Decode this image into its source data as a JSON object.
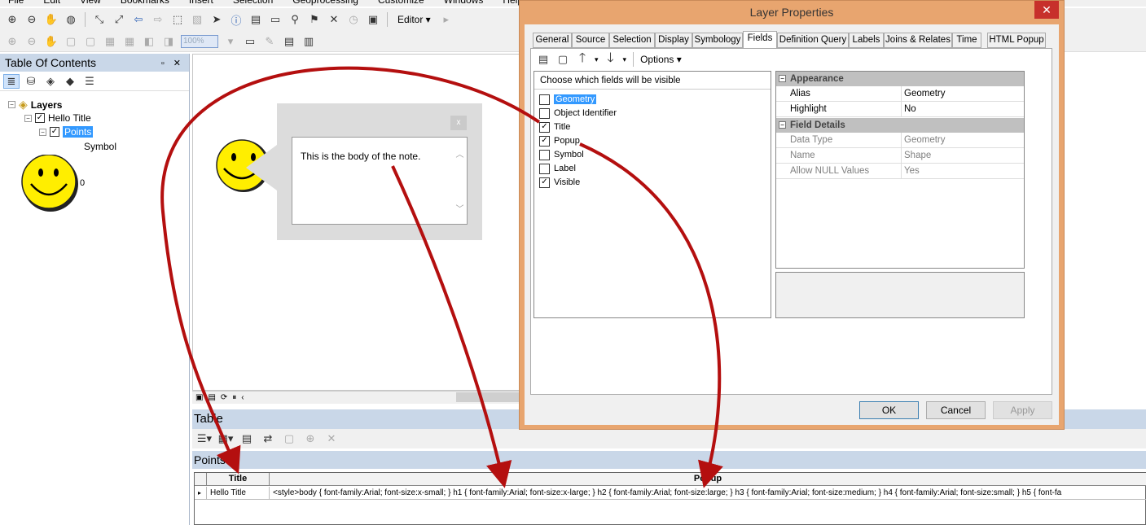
{
  "menu": [
    "File",
    "Edit",
    "View",
    "Bookmarks",
    "Insert",
    "Selection",
    "Geoprocessing",
    "Customize",
    "Windows",
    "Help"
  ],
  "toolbar": {
    "editor_label": "Editor ▾",
    "zoom_value": "100%"
  },
  "toc": {
    "title": "Table Of Contents",
    "controls": "▫ ✕",
    "layers_label": "Layers",
    "group_label": "Hello Title",
    "layer_label": "Points",
    "symbol_label": "Symbol",
    "legend_value": "0"
  },
  "note": {
    "close": "x",
    "body": "This is the body of the note."
  },
  "table": {
    "title": "Table",
    "tab_label": "Points",
    "columns": [
      "Title",
      "Popup"
    ],
    "rows": [
      {
        "title": "Hello Title",
        "popup": "<style>body { font-family:Arial; font-size:x-small; } h1 { font-family:Arial; font-size:x-large; } h2 { font-family:Arial; font-size:large; } h3 { font-family:Arial; font-size:medium; } h4 { font-family:Arial; font-size:small; } h5 { font-fa"
      }
    ]
  },
  "dialog": {
    "title": "Layer Properties",
    "close": "✕",
    "tabs": [
      "General",
      "Source",
      "Selection",
      "Display",
      "Symbology",
      "Fields",
      "Definition Query",
      "Labels",
      "Joins & Relates",
      "Time",
      "HTML Popup"
    ],
    "active_tab": "Fields",
    "options_label": "Options ▾",
    "fields_header": "Choose which fields will be visible",
    "fields": [
      {
        "name": "Geometry",
        "checked": false,
        "selected": true
      },
      {
        "name": "Object Identifier",
        "checked": false,
        "selected": false
      },
      {
        "name": "Title",
        "checked": true,
        "selected": false
      },
      {
        "name": "Popup",
        "checked": true,
        "selected": false
      },
      {
        "name": "Symbol",
        "checked": false,
        "selected": false
      },
      {
        "name": "Label",
        "checked": false,
        "selected": false
      },
      {
        "name": "Visible",
        "checked": true,
        "selected": false
      }
    ],
    "appearance": {
      "label": "Appearance",
      "rows": [
        {
          "k": "Alias",
          "v": "Geometry"
        },
        {
          "k": "Highlight",
          "v": "No"
        }
      ]
    },
    "field_details": {
      "label": "Field Details",
      "rows": [
        {
          "k": "Data Type",
          "v": "Geometry"
        },
        {
          "k": "Name",
          "v": "Shape"
        },
        {
          "k": "Allow NULL Values",
          "v": "Yes"
        }
      ]
    },
    "buttons": {
      "ok": "OK",
      "cancel": "Cancel",
      "apply": "Apply"
    }
  },
  "colors": {
    "arrow": "#b40f0f",
    "smiley": "#ffee00",
    "panel_header": "#c9d7e8",
    "selection": "#3399ff"
  }
}
